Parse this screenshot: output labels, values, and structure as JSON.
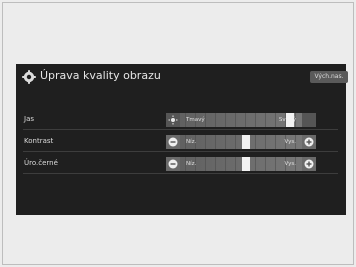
{
  "header": {
    "title": "Úprava kvality obrazu",
    "reset_label": "Vých.nas."
  },
  "rows": [
    {
      "label": "Jas",
      "low": "Tmavý",
      "high": "Světlý",
      "value_percent": 93
    },
    {
      "label": "Kontrast",
      "low": "Níz.",
      "high": "Vys.",
      "value_percent": 54
    },
    {
      "label": "Úro.černé",
      "low": "Níz.",
      "high": "Vys.",
      "value_percent": 54
    }
  ],
  "colors": {
    "screen_bg": "#1f1f1f",
    "accent_knob": "#f2f2f2"
  }
}
